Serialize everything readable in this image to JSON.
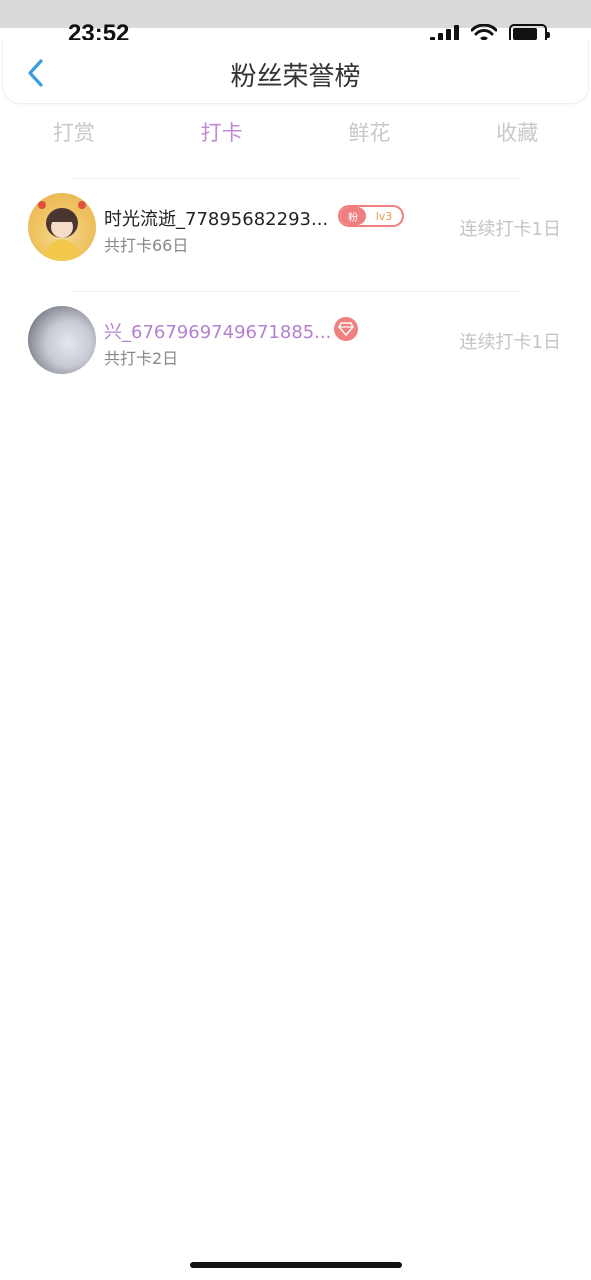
{
  "status_bar": {
    "time": "23:52"
  },
  "header": {
    "title": "粉丝荣誉榜"
  },
  "tabs": [
    {
      "label": "打赏"
    },
    {
      "label": "打卡"
    },
    {
      "label": "鲜花"
    },
    {
      "label": "收藏"
    }
  ],
  "active_tab": "打卡",
  "fans": [
    {
      "name": "时光流逝_77895682293...",
      "subtitle": "共打卡66日",
      "badge_left": "粉",
      "badge_right": "lv3",
      "streak": "连续打卡1日"
    },
    {
      "name": "兴_6767969749671885...",
      "subtitle": "共打卡2日",
      "streak": "连续打卡1日"
    }
  ],
  "colors": {
    "accent": "#c08ad6",
    "back_icon": "#3a9ee0",
    "badge": "#f07f7f"
  },
  "icons": {
    "back": "chevron-left-icon",
    "diamond": "diamond-icon",
    "wifi": "wifi-icon",
    "signal": "signal-icon",
    "battery": "battery-icon"
  }
}
